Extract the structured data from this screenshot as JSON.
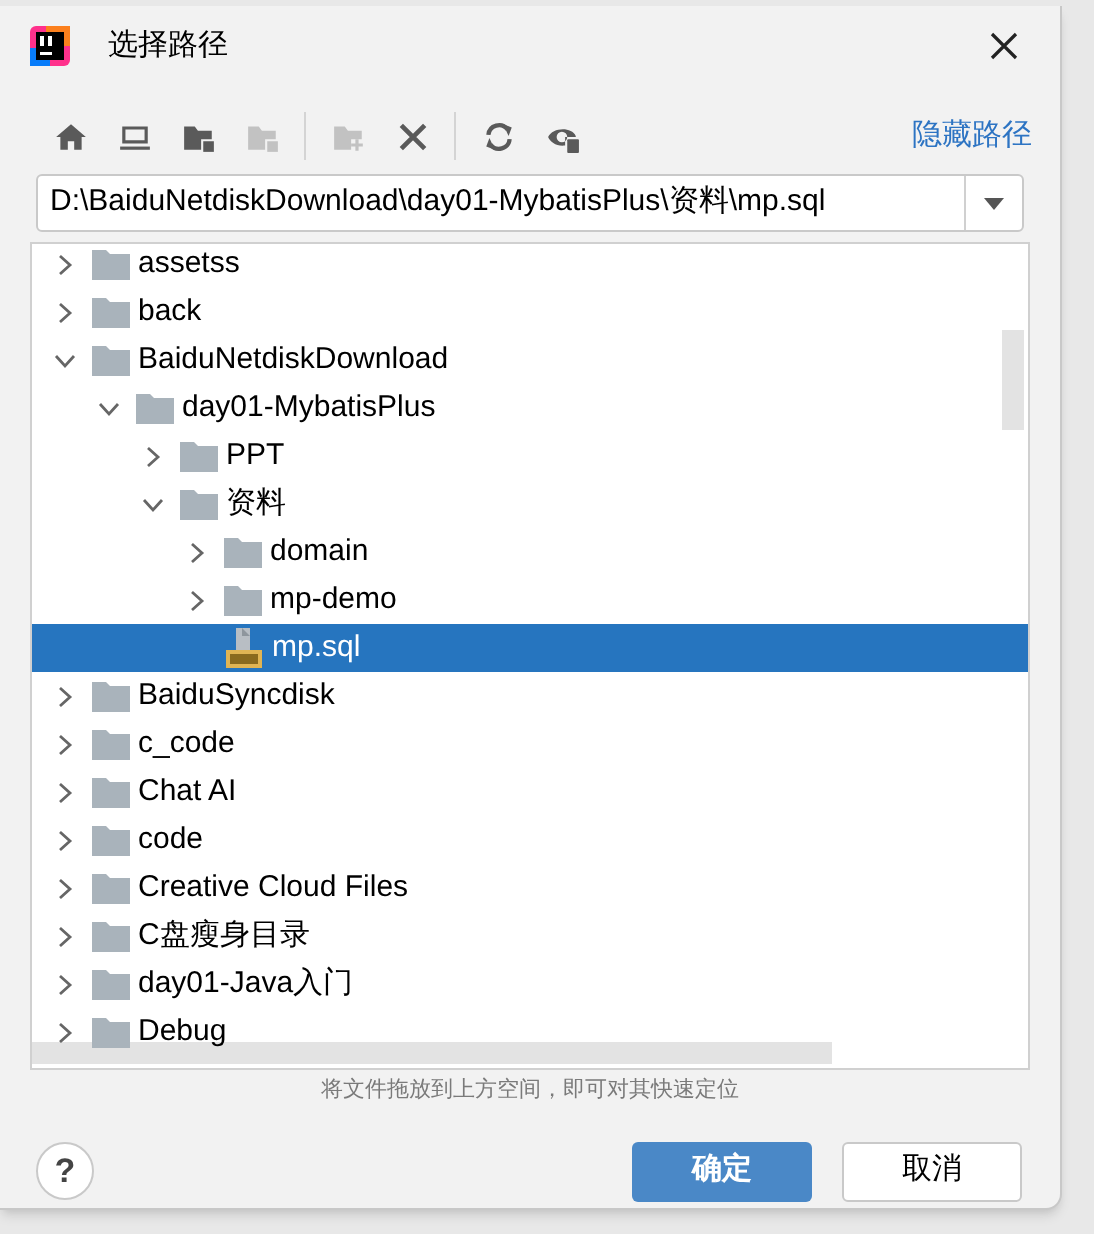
{
  "window": {
    "title": "选择路径"
  },
  "toolbar": [
    {
      "kind": "home",
      "disabled": false
    },
    {
      "kind": "monitor",
      "disabled": false
    },
    {
      "kind": "module-folder",
      "disabled": false
    },
    {
      "kind": "folder",
      "disabled": true
    },
    {
      "kind": "separator"
    },
    {
      "kind": "new-folder",
      "disabled": true
    },
    {
      "kind": "delete",
      "disabled": false
    },
    {
      "kind": "separator"
    },
    {
      "kind": "refresh",
      "disabled": false
    },
    {
      "kind": "show-hidden",
      "disabled": false
    }
  ],
  "toggle_path_link": "隐藏路径",
  "path_field": {
    "value": "D:\\BaiduNetdiskDownload\\day01-MybatisPlus\\资料\\mp.sql"
  },
  "tree": [
    {
      "label": "assetss",
      "kind": "folder",
      "expanded": false,
      "selected": false
    },
    {
      "label": "back",
      "kind": "folder",
      "expanded": false,
      "selected": false
    },
    {
      "label": "BaiduNetdiskDownload",
      "kind": "folder",
      "expanded": true,
      "selected": false,
      "children": [
        {
          "label": "day01-MybatisPlus",
          "kind": "folder",
          "expanded": true,
          "selected": false,
          "children": [
            {
              "label": "PPT",
              "kind": "folder",
              "expanded": false,
              "selected": false
            },
            {
              "label": "资料",
              "kind": "folder",
              "expanded": true,
              "selected": false,
              "children": [
                {
                  "label": "domain",
                  "kind": "folder",
                  "expanded": false,
                  "selected": false
                },
                {
                  "label": "mp-demo",
                  "kind": "folder",
                  "expanded": false,
                  "selected": false
                },
                {
                  "label": "mp.sql",
                  "kind": "sql-file",
                  "selected": true
                }
              ]
            }
          ]
        }
      ]
    },
    {
      "label": "BaiduSyncdisk",
      "kind": "folder",
      "expanded": false,
      "selected": false
    },
    {
      "label": "c_code",
      "kind": "folder",
      "expanded": false,
      "selected": false
    },
    {
      "label": "Chat AI",
      "kind": "folder",
      "expanded": false,
      "selected": false
    },
    {
      "label": "code",
      "kind": "folder",
      "expanded": false,
      "selected": false
    },
    {
      "label": "Creative Cloud Files",
      "kind": "folder",
      "expanded": false,
      "selected": false
    },
    {
      "label": "C盘瘦身目录",
      "kind": "folder",
      "expanded": false,
      "selected": false
    },
    {
      "label": "day01-Java入门",
      "kind": "folder",
      "expanded": false,
      "selected": false
    },
    {
      "label": "Debug",
      "kind": "folder",
      "expanded": false,
      "selected": false
    }
  ],
  "hint": "将文件拖放到上方空间，即可对其快速定位",
  "help_button": "?",
  "buttons": [
    {
      "label": "确定",
      "kind": "primary"
    },
    {
      "label": "取消",
      "kind": "secondary"
    }
  ]
}
